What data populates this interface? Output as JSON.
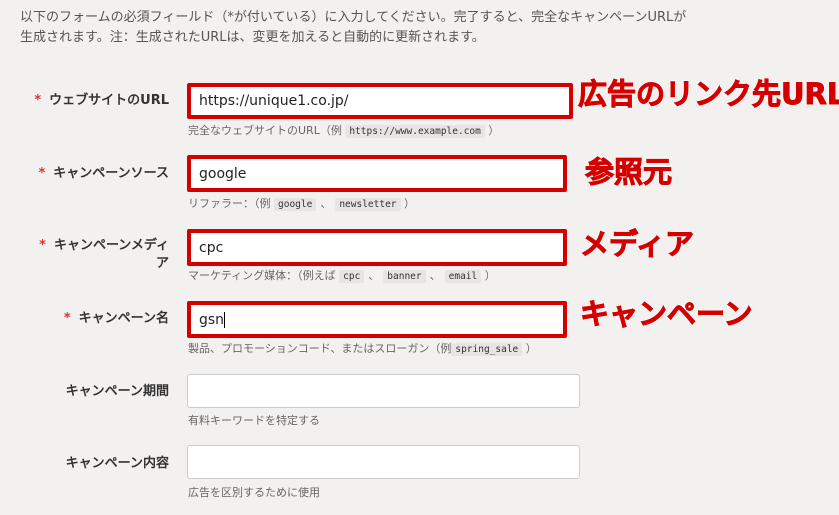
{
  "intro": {
    "line1": "以下のフォームの必須フィールド（*が付いている）に入力してください。完了すると、完全なキャンペーンURLが",
    "line2": "生成されます。注：生成されたURLは、変更を加えると自動的に更新されます。"
  },
  "required_mark": "*",
  "fields": {
    "website_url": {
      "label": "ウェブサイトのURL",
      "value": "https://unique1.co.jp/",
      "help_prefix": "完全なウェブサイトのURL（例",
      "help_examples": [
        "https://www.example.com"
      ],
      "help_suffix": "）",
      "annotation": "広告のリンク先URL"
    },
    "campaign_source": {
      "label": "キャンペーンソース",
      "value": "google",
      "help_prefix": "リファラー：（例",
      "help_examples": [
        "google",
        "newsletter"
      ],
      "help_sep": "、",
      "help_suffix": "）",
      "annotation": "参照元"
    },
    "campaign_medium": {
      "label_line1": "キャンペーンメディ",
      "label_line2": "ア",
      "value": "cpc",
      "help_prefix": "マーケティング媒体：（例えば",
      "help_examples": [
        "cpc",
        "banner",
        "email"
      ],
      "help_sep": "、",
      "help_suffix": "）",
      "annotation": "メディア"
    },
    "campaign_name": {
      "label": "キャンペーン名",
      "value": "gsn",
      "help_prefix": "製品、プロモーションコード、またはスローガン（例",
      "help_examples": [
        "spring_sale"
      ],
      "help_suffix": "）",
      "annotation": "キャンペーン"
    },
    "campaign_term": {
      "label": "キャンペーン期間",
      "value": "",
      "help": "有料キーワードを特定する"
    },
    "campaign_content": {
      "label": "キャンペーン内容",
      "value": "",
      "help": "広告を区別するために使用"
    }
  }
}
